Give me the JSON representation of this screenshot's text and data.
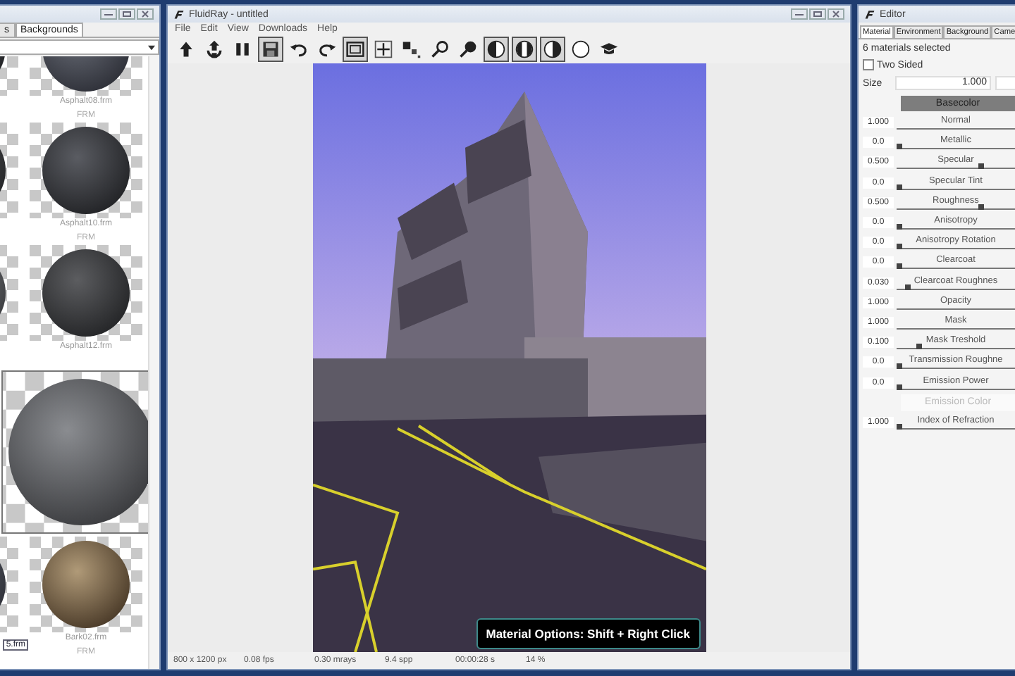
{
  "library": {
    "tabs": [
      {
        "label": "s",
        "selected": false
      },
      {
        "label": "Backgrounds",
        "selected": true
      }
    ],
    "rows": [
      {
        "kind": "cut",
        "label": "Asphalt08.frm",
        "tag": "FRM"
      },
      {
        "kind": "item",
        "label": "Asphalt10.frm",
        "tag": "FRM"
      },
      {
        "kind": "item",
        "label": "Asphalt12.frm"
      },
      {
        "kind": "preview"
      },
      {
        "kind": "item",
        "label": "Bark02.frm",
        "tag": "FRM",
        "side_label": "5.frm"
      }
    ]
  },
  "viewer": {
    "title": "FluidRay - untitled",
    "menu": [
      "File",
      "Edit",
      "View",
      "Downloads",
      "Help"
    ],
    "toolbar": [
      {
        "kind": "arrow-up",
        "selected": false
      },
      {
        "kind": "arrow-up-circle",
        "selected": false
      },
      {
        "kind": "pause",
        "selected": false
      },
      {
        "kind": "save",
        "selected": true
      },
      {
        "kind": "undo",
        "selected": false
      },
      {
        "kind": "redo",
        "selected": false
      },
      {
        "kind": "frame",
        "selected": true
      },
      {
        "kind": "move",
        "selected": false
      },
      {
        "kind": "squares",
        "selected": false
      },
      {
        "kind": "zoom",
        "selected": false
      },
      {
        "kind": "picker",
        "selected": false
      },
      {
        "kind": "half-left",
        "selected": true
      },
      {
        "kind": "half-both",
        "selected": true
      },
      {
        "kind": "half-right",
        "selected": true
      },
      {
        "kind": "circle",
        "selected": false
      },
      {
        "kind": "cap",
        "selected": false
      }
    ],
    "render": {
      "kind": "picture",
      "hint": "Material Options: Shift + Right Click"
    },
    "status_bar": [
      "800 x 1200 px",
      "0.08 fps",
      "0.30 mrays",
      "9.4 spp",
      "00:00:28 s",
      "14 %"
    ]
  },
  "editor": {
    "title": "Editor",
    "tabs": [
      {
        "label": "Material",
        "selected": true
      },
      {
        "label": "Environment",
        "selected": false
      },
      {
        "label": "Background",
        "selected": false
      },
      {
        "label": "Came",
        "selected": false
      }
    ],
    "selection": "6 materials selected",
    "two_sided": {
      "label": "Two Sided",
      "checked": false
    },
    "size": {
      "label": "Size",
      "value": "1.000"
    },
    "rows": [
      {
        "kind": "header",
        "label": "Basecolor"
      },
      {
        "kind": "line",
        "value": "1.000",
        "label": "Normal"
      },
      {
        "kind": "slider",
        "value": "0.0",
        "label": "Metallic",
        "level": 0
      },
      {
        "kind": "slider",
        "value": "0.500",
        "label": "Specular",
        "level": 0.72
      },
      {
        "kind": "slider",
        "value": "0.0",
        "label": "Specular Tint",
        "level": 0
      },
      {
        "kind": "slider",
        "value": "0.500",
        "label": "Roughness",
        "level": 0.72
      },
      {
        "kind": "slider",
        "value": "0.0",
        "label": "Anisotropy",
        "level": 0
      },
      {
        "kind": "slider",
        "value": "0.0",
        "label": "Anisotropy Rotation",
        "level": 0
      },
      {
        "kind": "slider",
        "value": "0.0",
        "label": "Clearcoat",
        "level": 0
      },
      {
        "kind": "slider",
        "value": "0.030",
        "label": "Clearcoat Roughnes",
        "level": 0.08
      },
      {
        "kind": "line",
        "value": "1.000",
        "label": "Opacity"
      },
      {
        "kind": "line",
        "value": "1.000",
        "label": "Mask"
      },
      {
        "kind": "slider",
        "value": "0.100",
        "label": "Mask Treshold",
        "level": 0.18
      },
      {
        "kind": "slider",
        "value": "0.0",
        "label": "Transmission Roughne",
        "level": 0
      },
      {
        "kind": "slider",
        "value": "0.0",
        "label": "Emission Power",
        "level": 0
      },
      {
        "kind": "button",
        "label": "Emission Color"
      },
      {
        "kind": "slider",
        "value": "1.000",
        "label": "Index of Refraction",
        "level": 0
      }
    ]
  }
}
